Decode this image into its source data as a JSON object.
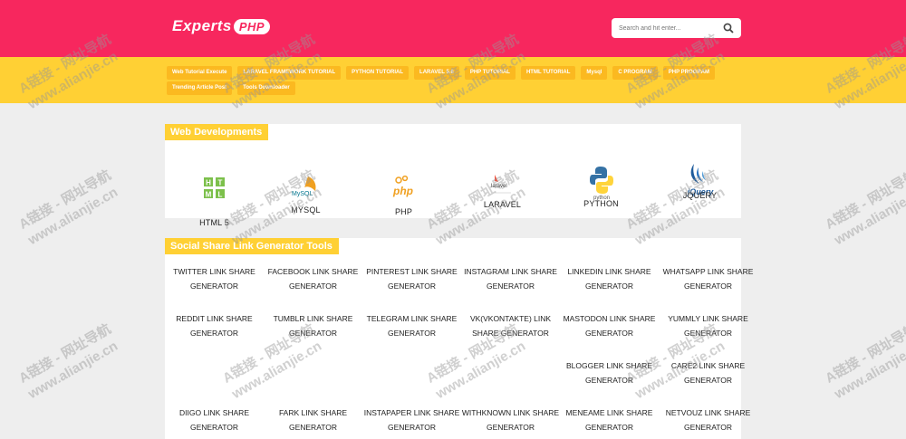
{
  "header": {
    "logo_text": "Experts",
    "logo_badge": "PHP",
    "search_placeholder": "Search and hit enter..."
  },
  "nav": {
    "row1": [
      "Web Tutorial Execute",
      "LARAVEL FRAMEWORK TUTORIAL",
      "PYTHON TUTORIAL",
      "LARAVEL 5.6",
      "PHP TUTORIAL",
      "HTML TUTORIAL",
      "Mysql",
      "C PROGRAM",
      "PHP PROGRAM"
    ],
    "row2": [
      "Trending Article Post",
      "Tools Downloader"
    ]
  },
  "web_dev": {
    "title": "Web Developments",
    "items": [
      {
        "label": "HTML 5",
        "icon": "html5-icon"
      },
      {
        "label": "MYSQL",
        "icon": "mysql-icon"
      },
      {
        "label": "PHP",
        "icon": "php-icon"
      },
      {
        "label": "LARAVEL",
        "icon": "laravel-icon"
      },
      {
        "label": "PYTHON",
        "icon": "python-icon"
      },
      {
        "label": "JQUERY",
        "icon": "jquery-icon"
      }
    ],
    "icon_texts": {
      "mysql": "MySQL",
      "php": "php",
      "laravel": "laravel",
      "python": "python",
      "jquery": "jQuery"
    }
  },
  "social": {
    "title": "Social Share Link Generator Tools",
    "rows": [
      [
        "TWITTER LINK SHARE GENERATOR",
        "FACEBOOK LINK SHARE GENERATOR",
        "PINTEREST LINK SHARE GENERATOR",
        "INSTAGRAM LINK SHARE GENERATOR",
        "LINKEDIN LINK SHARE GENERATOR",
        "WHATSAPP LINK SHARE GENERATOR"
      ],
      [
        "REDDIT LINK SHARE GENERATOR",
        "TUMBLR LINK SHARE GENERATOR",
        "TELEGRAM LINK SHARE GENERATOR",
        "VK(VKONTAKTE) LINK SHARE GENERATOR",
        "MASTODON LINK SHARE GENERATOR",
        "YUMMLY LINK SHARE GENERATOR"
      ],
      [
        "",
        "",
        "",
        "",
        "BLOGGER LINK SHARE GENERATOR",
        "CARE2 LINK SHARE GENERATOR"
      ],
      [
        "DIIGO LINK SHARE GENERATOR",
        "FARK LINK SHARE GENERATOR",
        "INSTAPAPER LINK SHARE GENERATOR",
        "WITHKNOWN LINK SHARE GENERATOR",
        "MENEAME LINK SHARE GENERATOR",
        "NETVOUZ LINK SHARE GENERATOR"
      ]
    ]
  },
  "watermark": {
    "line1": "A链接 - 网址导航",
    "line2": "www.alianjie.cn"
  },
  "colors": {
    "header": "#f7275e",
    "nav": "#ffd034",
    "nav_button": "#fbb920"
  }
}
